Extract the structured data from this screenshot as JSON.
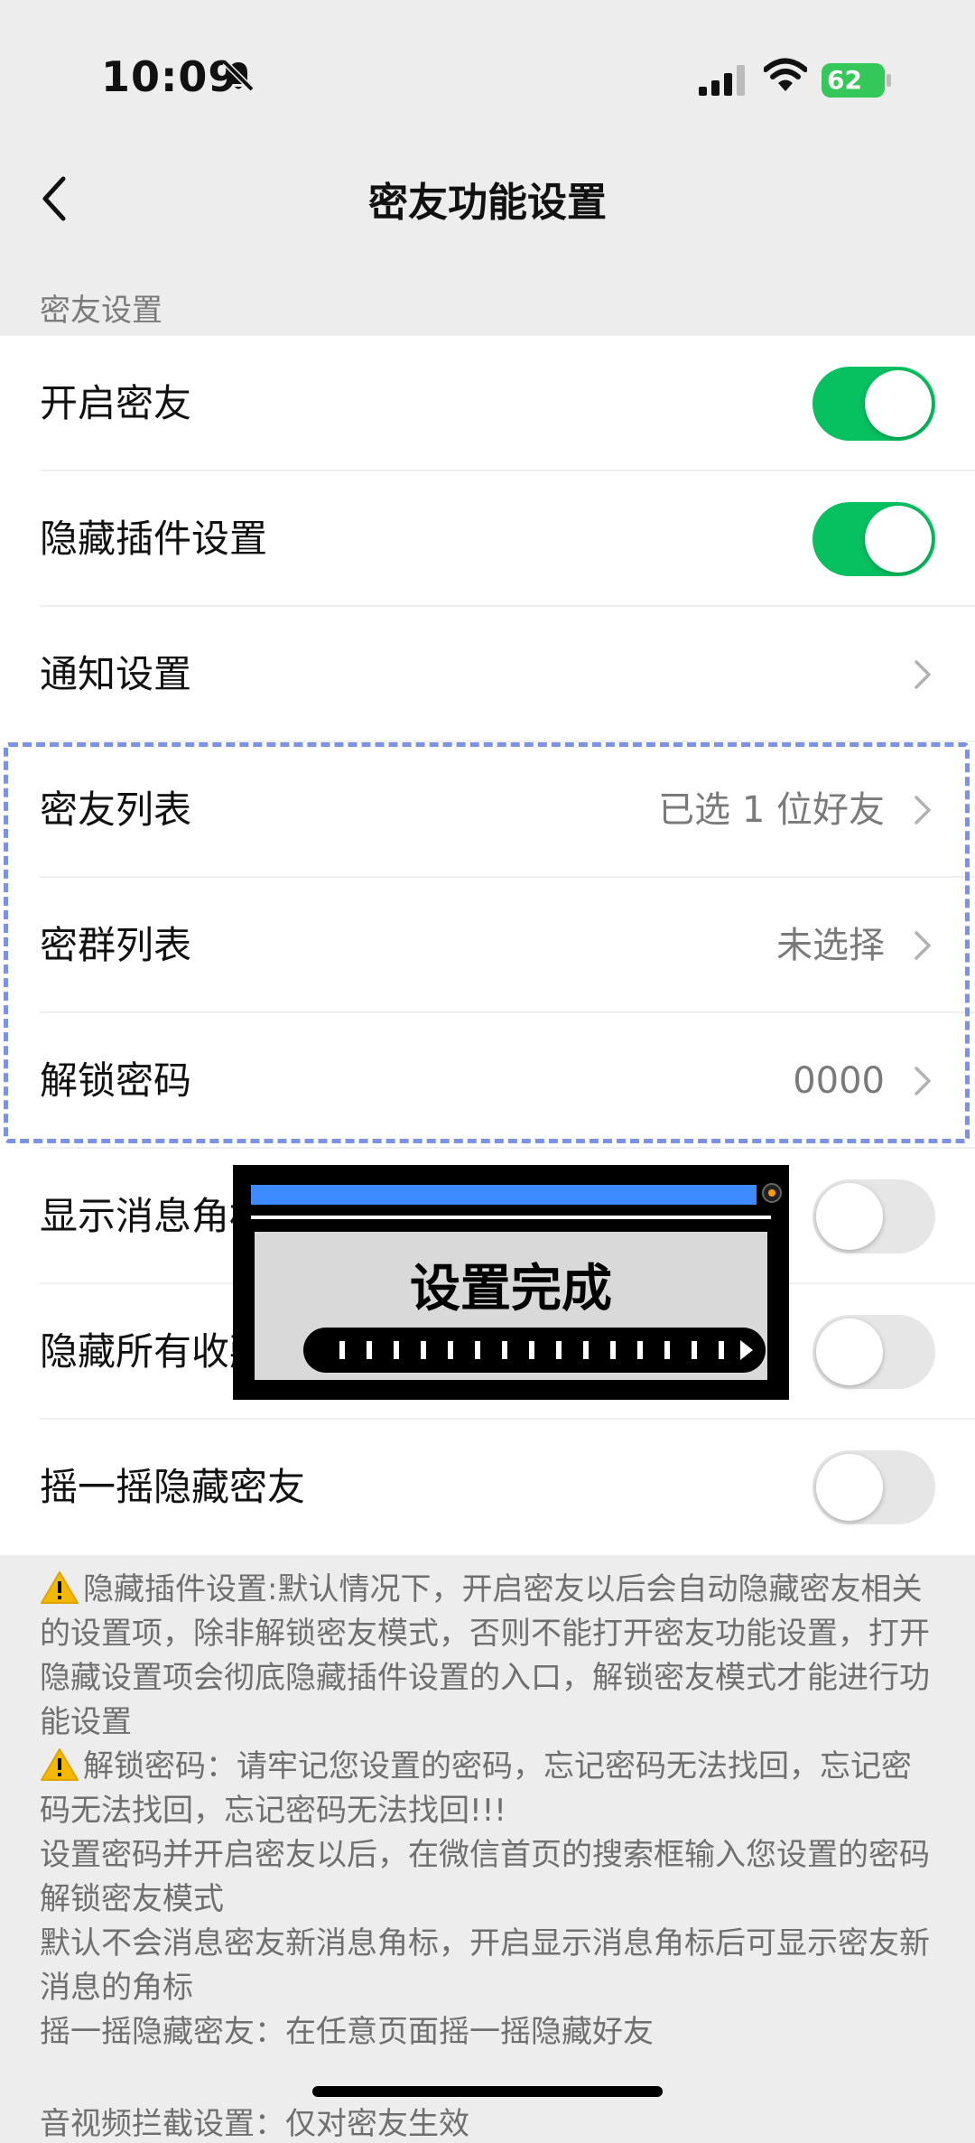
{
  "status_bar": {
    "time": "10:09",
    "battery": "62"
  },
  "nav": {
    "title": "密友功能设置",
    "back_icon": "chevron-left-icon"
  },
  "section_header": "密友设置",
  "settings": [
    {
      "label": "开启密友",
      "type": "toggle",
      "on": true
    },
    {
      "label": "隐藏插件设置",
      "type": "toggle",
      "on": true
    },
    {
      "label": "通知设置",
      "type": "link",
      "value": ""
    },
    {
      "label": "密友列表",
      "type": "link",
      "value": "已选 1 位好友"
    },
    {
      "label": "密群列表",
      "type": "link",
      "value": "未选择"
    },
    {
      "label": "解锁密码",
      "type": "link",
      "value": "0000"
    },
    {
      "label": "显示消息角标",
      "type": "toggle",
      "on": false
    },
    {
      "label": "隐藏所有收藏",
      "type": "toggle",
      "on": false
    },
    {
      "label": "摇一摇隐藏密友",
      "type": "toggle",
      "on": false
    }
  ],
  "popup": {
    "text": "设置完成"
  },
  "notes": [
    "隐藏插件设置:默认情况下，开启密友以后会自动隐藏密友相关的设置项，除非解锁密友模式，否则不能打开密友功能设置，打开隐藏设置项会彻底隐藏插件设置的入口，解锁密友模式才能进行功能设置",
    "解锁密码：请牢记您设置的密码，忘记密码无法找回，忘记密码无法找回，忘记密码无法找回!!!",
    "设置密码并开启密友以后，在微信首页的搜索框输入您设置的密码解锁密友模式",
    "默认不会消息密友新消息角标，开启显示消息角标后可显示密友新消息的角标",
    "摇一摇隐藏密友：在任意页面摇一摇隐藏好友"
  ],
  "notes_cut": "音视频拦截设置：仅对密友生效",
  "colors": {
    "toggle_on": "#07c160",
    "dashed_border": "#7b93e6",
    "popup_bar": "#3d8bff"
  }
}
